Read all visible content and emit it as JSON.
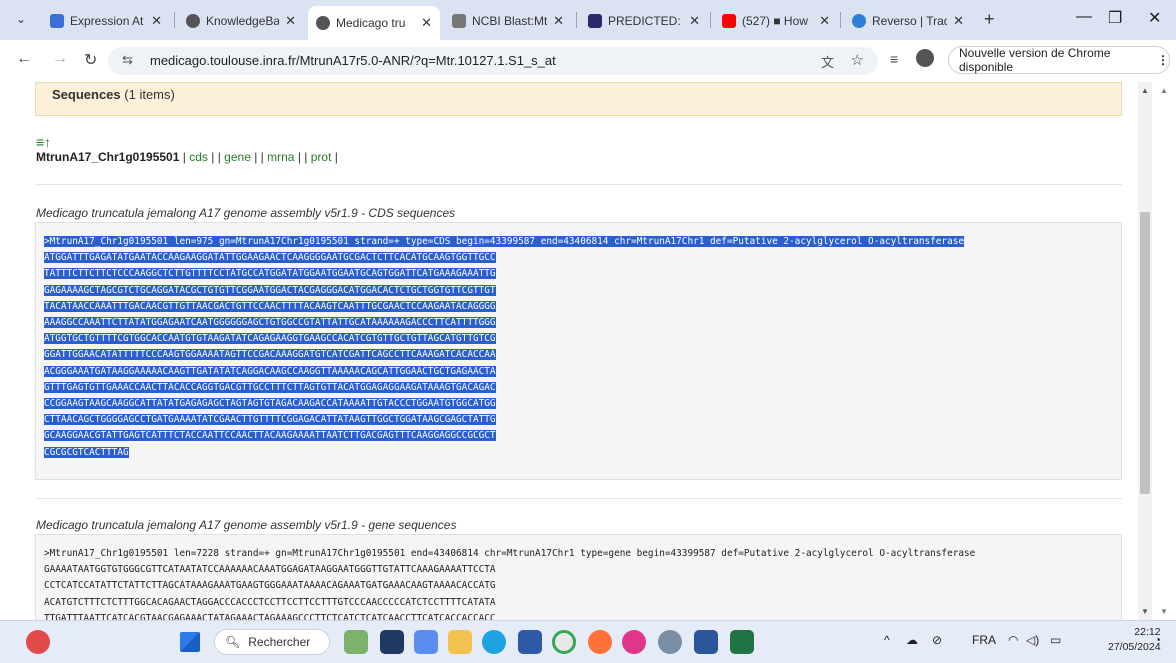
{
  "tabs": [
    {
      "title": "Expression At",
      "color": "#3b6fd6"
    },
    {
      "title": "KnowledgeBa",
      "color": "#555555"
    },
    {
      "title": "Medicago tru",
      "color": "#555555"
    },
    {
      "title": "NCBI Blast:Mt",
      "color": "#555555"
    },
    {
      "title": "PREDICTED: M",
      "color": "#2a2a6a"
    },
    {
      "title": "(527) ■ How",
      "color": "#ff0000"
    },
    {
      "title": "Reverso | Trad",
      "color": "#2e7fd6"
    }
  ],
  "address": {
    "url": "medicago.toulouse.inra.fr/MtrunA17r5.0-ANR/?q=Mtr.10127.1.S1_s_at",
    "update_text": "Nouvelle version de Chrome disponible"
  },
  "page": {
    "sequences_label": "Sequences",
    "sequences_count": "(1 items)",
    "gene_id": "MtrunA17_Chr1g0195501",
    "links": [
      "cds",
      "gene",
      "mrna",
      "prot"
    ],
    "cds_title": "Medicago truncatula jemalong A17 genome assembly v5r1.9 - CDS sequences",
    "gene_title": "Medicago truncatula jemalong A17 genome assembly v5r1.9 - gene sequences",
    "cds_lines": [
      ">MtrunA17_Chr1g0195501 len=975 gn=MtrunA17Chr1g0195501 strand=+ type=CDS begin=43399587 end=43406814 chr=MtrunA17Chr1 def=Putative 2-acylglycerol O-acyltransferase",
      "ATGGATTTGAGATATGAATACCAAGAAGGATATTGGAAGAACTCAAGGGGAATGCGACTCTTCACATGCAAGTGGTTGCC",
      "TATTTCTTCTTCTCCCAAGGCTCTTGTTTTCCTATGCCATGGATATGGAATGGAATGCAGTGGATTCATGAAAGAAATTG",
      "GAGAAAAGCTAGCGTCTGCAGGATACGCTGTGTTCGGAATGGACTACGAGGGACATGGACACTCTGCTGGTGTTCGTTGT",
      "TACATAACCAAATTTGACAACGTTGTTAACGACTGTTCCAACTTTTACAAGTCAATTTGCGAACTCCAAGAATACAGGGG",
      "AAAGGCCAAATTCTTATATGGAGAATCAATGGGGGGAGCTGTGGCCGTATTATTGCATAAAAAAGACCCTTCATTTTGGG",
      "ATGGTGCTGTTTTCGTGGCACCAATGTGTAAGATATCAGAGAAGGTGAAGCCACATCGTGTTGCTGTTAGCATGTTGTCG",
      "GGATTGGAACATATTTTTCCCAAGTGGAAAATAGTTCCGACAAAGGATGTCATCGATTCAGCCTTCAAAGATCACACCAA",
      "ACGGGAAATGATAAGGAAAAACAAGTTGATATATCAGGACAAGCCAAGGTTAAAAACAGCATTGGAACTGCTGAGAACTA",
      "GTTTGAGTGTTGAAACCAACTTACACCAGGTGACGTTGCCTTTCTTAGTGTTACATGGAGAGGAAGATAAAGTGACAGAC",
      "CCGGAAGTAAGCAAGGCATTATATGAGAGAGCTAGTAGTGTAGACAAGACCATAAAATTGTACCCTGGAATGTGGCATGG",
      "CTTAACAGCTGGGGAGCCTGATGAAAATATCGAACTTGTTTTCGGAGACATTATAAGTTGGCTGGATAAGCGAGCTATTG",
      "GCAAGGAACGTATTGAGTCATTTCTACCAATTCCAACTTACAAGAAAATTAATCTTGACGAGTTTCAAGGAGGCCGCGCT",
      "CGCGCGTCACTTTAG"
    ],
    "gene_lines": [
      ">MtrunA17_Chr1g0195501 len=7228 strand=+ gn=MtrunA17Chr1g0195501 end=43406814 chr=MtrunA17Chr1 type=gene begin=43399587 def=Putative 2-acylglycerol O-acyltransferase",
      "GAAAATAATGGTGTGGGCGTTCATAATATCCAAAAAACAAATGGAGATAAGGAATGGGTTGTATTCAAAGAAAATTCCTA",
      "CCTCATCCATATTCTATTCTTAGCATAAAGAAATGAAGTGGGAAATAAAACAGAAATGATGAAACAAGTAAAACACCATG",
      "ACATGTCTTTCTCTTTGGCACAGAACTAGGACCCACCCTCCTTCCTTCCTTTGTCCCAACCCCCATCTCCTTTTCATATA",
      "TTGATTTAATTCATCACGTAACGAGAAACTATAGAAACTAGAAAGCCCTTCTCATCTCATCAACCTTCATCACCACCACC"
    ]
  },
  "taskbar": {
    "search_placeholder": "Rechercher",
    "lang": "FRA",
    "time": "22:12",
    "date": "27/05/2024"
  }
}
